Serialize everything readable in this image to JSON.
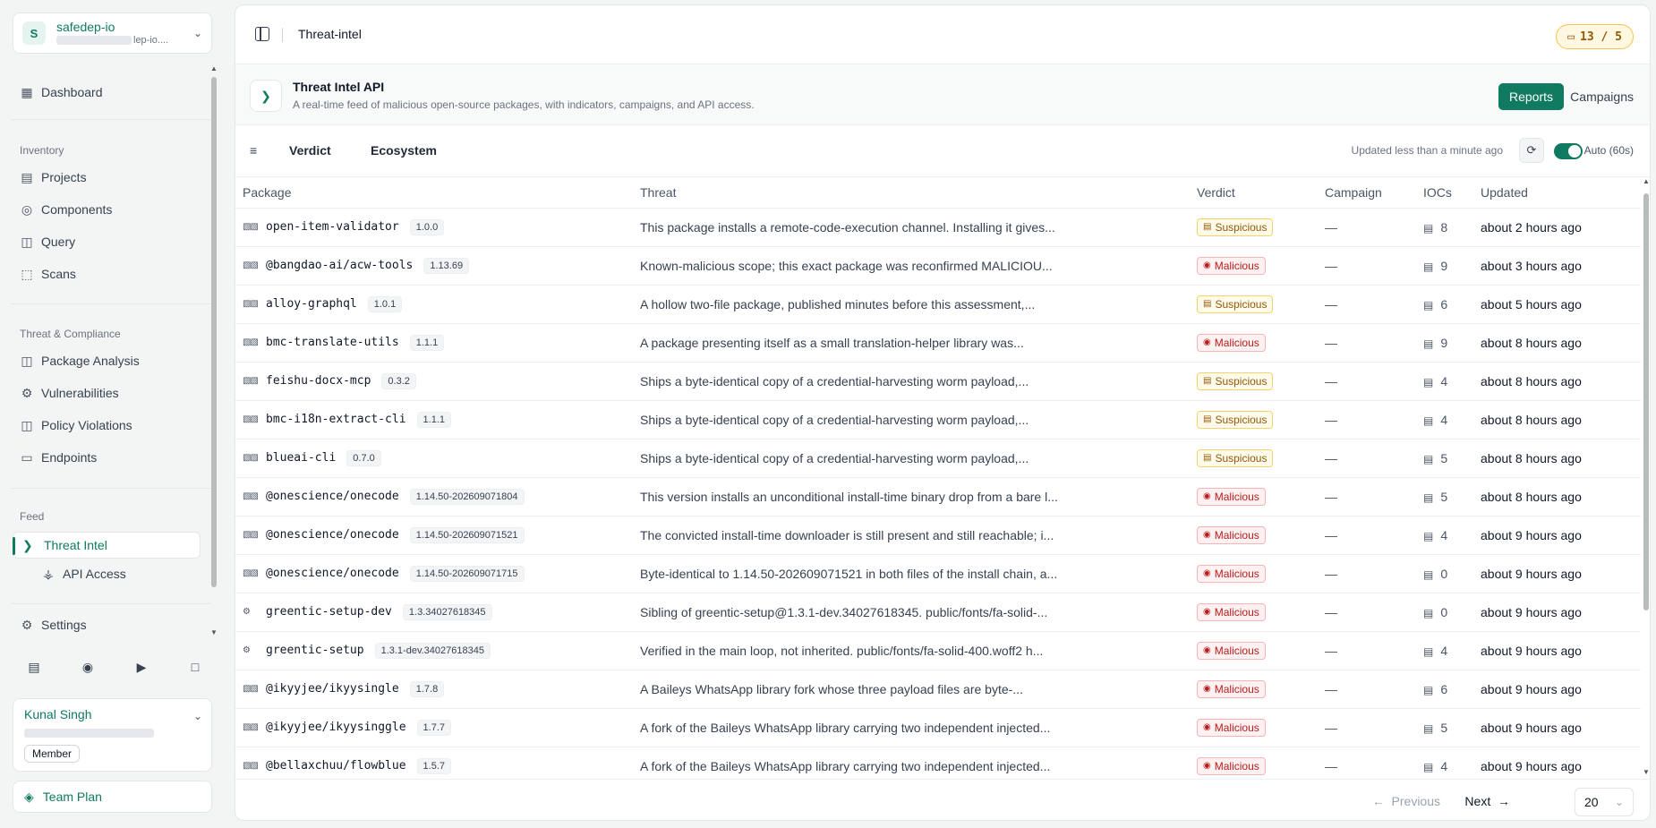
{
  "org": {
    "initial": "S",
    "name": "safedep-io",
    "sub_suffix": "lep-io...."
  },
  "nav": {
    "dashboard": "Dashboard",
    "inventory_section": "Inventory",
    "projects": "Projects",
    "components": "Components",
    "query": "Query",
    "scans": "Scans",
    "threat_section": "Threat & Compliance",
    "package_analysis": "Package Analysis",
    "vulnerabilities": "Vulnerabilities",
    "policy_violations": "Policy Violations",
    "endpoints": "Endpoints",
    "feed_section": "Feed",
    "threat_intel": "Threat Intel",
    "api_access": "API Access",
    "settings": "Settings"
  },
  "user": {
    "name": "Kunal Singh",
    "role": "Member"
  },
  "plan": {
    "label": "Team Plan"
  },
  "topbar": {
    "breadcrumb": "Threat-intel",
    "credits": "13 / 5"
  },
  "header": {
    "title": "Threat Intel API",
    "subtitle": "A real-time feed of malicious open-source packages, with indicators, campaigns, and API access.",
    "reports": "Reports",
    "campaigns": "Campaigns"
  },
  "filters": {
    "verdict": "Verdict",
    "ecosystem": "Ecosystem",
    "updated": "Updated less than a minute ago",
    "auto": "Auto (60s)"
  },
  "table": {
    "columns": {
      "package": "Package",
      "threat": "Threat",
      "verdict": "Verdict",
      "campaign": "Campaign",
      "iocs": "IOCs",
      "updated": "Updated"
    },
    "rows": [
      {
        "eco": "npm",
        "name": "open-item-validator",
        "version": "1.0.0",
        "threat": "This package installs a remote-code-execution channel. Installing it gives...",
        "verdict": "Suspicious",
        "campaign": "—",
        "iocs": "8",
        "updated": "about 2 hours ago"
      },
      {
        "eco": "npm",
        "name": "@bangdao-ai/acw-tools",
        "version": "1.13.69",
        "threat": "Known-malicious scope; this exact package was reconfirmed MALICIOU...",
        "verdict": "Malicious",
        "campaign": "—",
        "iocs": "9",
        "updated": "about 3 hours ago"
      },
      {
        "eco": "npm",
        "name": "alloy-graphql",
        "version": "1.0.1",
        "threat": "A hollow two-file package, published minutes before this assessment,...",
        "verdict": "Suspicious",
        "campaign": "—",
        "iocs": "6",
        "updated": "about 5 hours ago"
      },
      {
        "eco": "npm",
        "name": "bmc-translate-utils",
        "version": "1.1.1",
        "threat": "A package presenting itself as a small translation-helper library was...",
        "verdict": "Malicious",
        "campaign": "—",
        "iocs": "9",
        "updated": "about 8 hours ago"
      },
      {
        "eco": "npm",
        "name": "feishu-docx-mcp",
        "version": "0.3.2",
        "threat": "Ships a byte-identical copy of a credential-harvesting worm payload,...",
        "verdict": "Suspicious",
        "campaign": "—",
        "iocs": "4",
        "updated": "about 8 hours ago"
      },
      {
        "eco": "npm",
        "name": "bmc-i18n-extract-cli",
        "version": "1.1.1",
        "threat": "Ships a byte-identical copy of a credential-harvesting worm payload,...",
        "verdict": "Suspicious",
        "campaign": "—",
        "iocs": "4",
        "updated": "about 8 hours ago"
      },
      {
        "eco": "npm",
        "name": "blueai-cli",
        "version": "0.7.0",
        "threat": "Ships a byte-identical copy of a credential-harvesting worm payload,...",
        "verdict": "Suspicious",
        "campaign": "—",
        "iocs": "5",
        "updated": "about 8 hours ago"
      },
      {
        "eco": "npm",
        "name": "@onescience/onecode",
        "version": "1.14.50-202609071804",
        "threat": "This version installs an unconditional install-time binary drop from a bare l...",
        "verdict": "Malicious",
        "campaign": "—",
        "iocs": "5",
        "updated": "about 8 hours ago"
      },
      {
        "eco": "npm",
        "name": "@onescience/onecode",
        "version": "1.14.50-202609071521",
        "threat": "The convicted install-time downloader is still present and still reachable; i...",
        "verdict": "Malicious",
        "campaign": "—",
        "iocs": "4",
        "updated": "about 9 hours ago"
      },
      {
        "eco": "npm",
        "name": "@onescience/onecode",
        "version": "1.14.50-202609071715",
        "threat": "Byte-identical to 1.14.50-202609071521 in both files of the install chain, a...",
        "verdict": "Malicious",
        "campaign": "—",
        "iocs": "0",
        "updated": "about 9 hours ago"
      },
      {
        "eco": "crates",
        "name": "greentic-setup-dev",
        "version": "1.3.34027618345",
        "threat": "Sibling of greentic-setup@1.3.1-dev.34027618345. public/fonts/fa-solid-...",
        "verdict": "Malicious",
        "campaign": "—",
        "iocs": "0",
        "updated": "about 9 hours ago"
      },
      {
        "eco": "crates",
        "name": "greentic-setup",
        "version": "1.3.1-dev.34027618345",
        "threat": "Verified in the main loop, not inherited. public/fonts/fa-solid-400.woff2 h...",
        "verdict": "Malicious",
        "campaign": "—",
        "iocs": "4",
        "updated": "about 9 hours ago"
      },
      {
        "eco": "npm",
        "name": "@ikyyjee/ikyysingle",
        "version": "1.7.8",
        "threat": "A Baileys WhatsApp library fork whose three payload files are byte-...",
        "verdict": "Malicious",
        "campaign": "—",
        "iocs": "6",
        "updated": "about 9 hours ago"
      },
      {
        "eco": "npm",
        "name": "@ikyyjee/ikyysinggle",
        "version": "1.7.7",
        "threat": "A fork of the Baileys WhatsApp library carrying two independent injected...",
        "verdict": "Malicious",
        "campaign": "—",
        "iocs": "5",
        "updated": "about 9 hours ago"
      },
      {
        "eco": "npm",
        "name": "@bellaxchuu/flowblue",
        "version": "1.5.7",
        "threat": "A fork of the Baileys WhatsApp library carrying two independent injected...",
        "verdict": "Malicious",
        "campaign": "—",
        "iocs": "4",
        "updated": "about 9 hours ago"
      }
    ]
  },
  "pager": {
    "previous": "Previous",
    "next": "Next",
    "page_size": "20"
  },
  "colors": {
    "brand": "#0f7a5f",
    "suspicious": "#92580c",
    "malicious": "#b91c1c"
  }
}
